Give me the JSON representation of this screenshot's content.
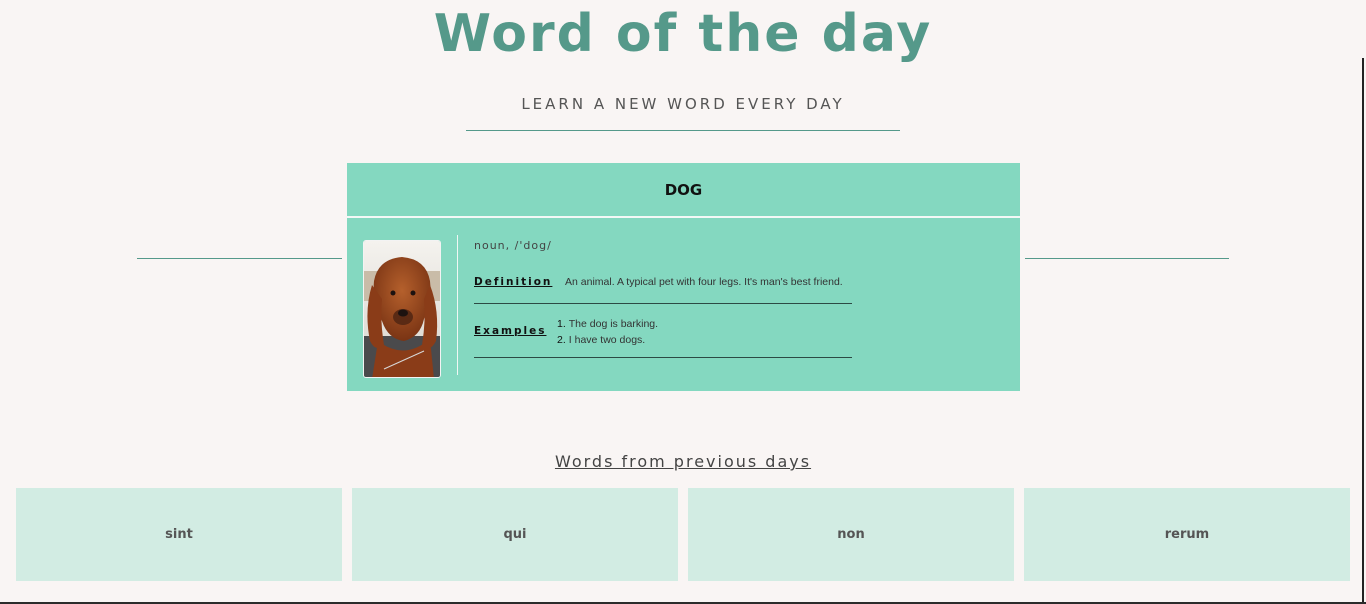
{
  "header": {
    "title": "Word of the day",
    "subtitle": "LEARN A NEW WORD EVERY DAY"
  },
  "word": {
    "name": "DOG",
    "part_of_speech": "noun, /'dog/",
    "definition_label": "Definition",
    "definition": "An animal. A typical pet with four legs. It's man's best friend.",
    "examples_label": "Examples",
    "examples": [
      {
        "num": "1.",
        "text": "The dog is barking."
      },
      {
        "num": "2.",
        "text": "I have two dogs."
      }
    ],
    "image_icon": "dog-photo"
  },
  "previous": {
    "title": "Words from previous days",
    "words": [
      "sint",
      "qui",
      "non",
      "rerum"
    ]
  },
  "colors": {
    "accent": "#55998a",
    "card": "#84d8c0",
    "prev_card": "#d2ece3",
    "background": "#f9f5f4"
  }
}
